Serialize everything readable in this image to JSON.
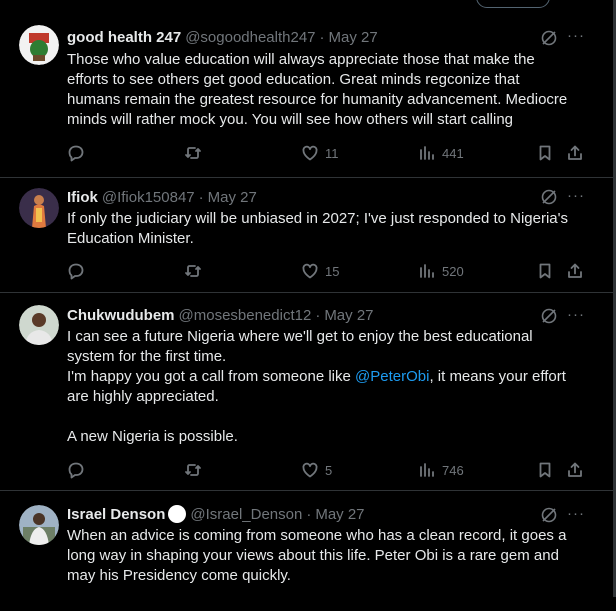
{
  "tweets": [
    {
      "name": "good health 247",
      "handle": "@sogoodhealth247",
      "date": "May 27",
      "verified": false,
      "lines": [
        "Those who value education will always appreciate those that make the",
        "efforts to see others get good education. Great minds regconize that",
        "humans remain the greatest resource for humanity advancement. Mediocre",
        "minds will rather mock you. You will see how others will start calling"
      ],
      "stats": {
        "replies": "",
        "reposts": "",
        "likes": "11",
        "views": "441"
      }
    },
    {
      "name": "Ifiok",
      "handle": "@Ifiok150847",
      "date": "May 27",
      "verified": false,
      "lines": [
        "If only the judiciary will be unbiased in 2027; I've just responded to Nigeria's",
        "Education Minister."
      ],
      "stats": {
        "replies": "",
        "reposts": "",
        "likes": "15",
        "views": "520"
      }
    },
    {
      "name": "Chukwudubem",
      "handle": "@mosesbenedict12",
      "date": "May 27",
      "verified": false,
      "lines": [
        "I can see a future Nigeria where we'll get to enjoy the best educational",
        "system for the first time."
      ],
      "line3_pre": "I'm happy you got a call from someone like ",
      "line3_mention": "@PeterObi",
      "line3_post": ", it means your effort",
      "line4": "are highly appreciated.",
      "line5": "A new Nigeria is possible.",
      "stats": {
        "replies": "",
        "reposts": "",
        "likes": "5",
        "views": "746"
      }
    },
    {
      "name": "Israel Denson",
      "handle": "@Israel_Denson",
      "date": "May 27",
      "verified": true,
      "lines": [
        "When an advice is coming from someone who has a clean record, it goes a",
        "long way in shaping your views about this life. Peter Obi is a rare gem and",
        "may his Presidency come quickly."
      ]
    }
  ],
  "separator": "·",
  "more_glyph": "···",
  "colors": {
    "background": "#000000",
    "text": "#e7e9ea",
    "muted": "#71767b",
    "link": "#1d9bf0",
    "border": "#2f3336"
  },
  "icons": [
    "reply-icon",
    "repost-icon",
    "like-icon",
    "views-icon",
    "bookmark-icon",
    "share-icon",
    "grok-icon",
    "more-icon",
    "verified-badge-icon"
  ]
}
